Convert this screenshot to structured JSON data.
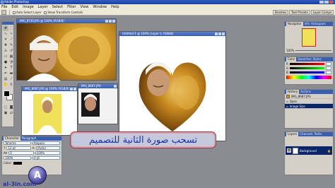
{
  "app": {
    "title": "Adobe Photoshop",
    "menu": [
      "File",
      "Edit",
      "Image",
      "Layer",
      "Select",
      "Filter",
      "View",
      "Window",
      "Help"
    ]
  },
  "options_bar": {
    "auto_select_layer": "Auto Select Layer",
    "show_transform_controls": "Show Transform Controls"
  },
  "palette_well": [
    "Brushes",
    "Tool Presets",
    "Layer Comps"
  ],
  "documents": [
    {
      "title": "IMG_8730.JPG @ 100% (RGB/8)"
    },
    {
      "title": "Untitled-1 @ 100% (Layer 1, RGB/8)"
    },
    {
      "title": "IMG_8687.JPG"
    },
    {
      "title": "IMG_8687.JPG @ 100% (RGB/8)"
    }
  ],
  "character_panel": {
    "tabs": [
      "Character",
      "Paragraph"
    ],
    "font_family": "Tahoma",
    "font_style": "Regular",
    "font_size": "12 pt",
    "leading": "(Auto)",
    "tracking": "0",
    "scale_v": "100%",
    "scale_h": "100%",
    "baseline": "0 pt",
    "color_label": "Color:"
  },
  "navigator_panel": {
    "tabs": [
      "Navigator",
      "Info",
      "Histogram"
    ],
    "zoom": "100%"
  },
  "color_panel": {
    "tabs": [
      "Color",
      "Swatches",
      "Styles"
    ],
    "channels": [
      "R",
      "G",
      "B"
    ]
  },
  "history_panel": {
    "tabs": [
      "History",
      "Actions"
    ],
    "snapshot": "IMG_8687.JPG",
    "items": [
      "Open",
      "Image Size"
    ]
  },
  "layers_panel": {
    "tabs": [
      "Layers",
      "Channels",
      "Paths"
    ],
    "layers": [
      {
        "name": "Background"
      }
    ]
  },
  "caption": "تسحب صورة الثانية للتصميم",
  "watermark": {
    "site": "al-3in.com",
    "logo_letter": "A"
  },
  "colors": {
    "accent_blue": "#3a5fb0",
    "caption_text": "#1c2fa8",
    "caption_border": "#e0a0ac",
    "workspace": "#8a8c91"
  }
}
